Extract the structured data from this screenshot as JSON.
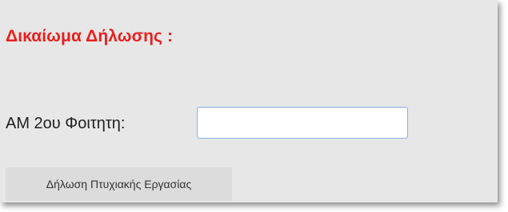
{
  "form": {
    "heading": "Δικαίωμα Δήλωσης :",
    "student_id_label": "AM 2ου Φοιτητη:",
    "student_id_value": "",
    "submit_label": "Δήλωση Πτυχιακής Εργασίας"
  },
  "colors": {
    "heading": "#e8201e",
    "panel_background": "#e7e7e7",
    "input_border": "#8fb3e0",
    "button_background": "#dcdcdc"
  }
}
